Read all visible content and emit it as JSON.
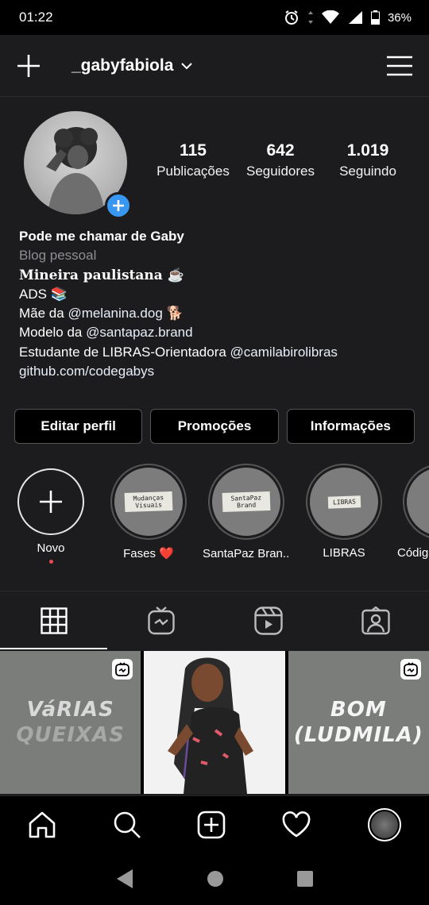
{
  "status": {
    "time": "01:22",
    "battery": "36%"
  },
  "header": {
    "username": "_gabyfabiola"
  },
  "stats": [
    {
      "value": "115",
      "label": "Publicações"
    },
    {
      "value": "642",
      "label": "Seguidores"
    },
    {
      "value": "1.019",
      "label": "Seguindo"
    }
  ],
  "bio": {
    "name": "Pode me chamar de Gaby",
    "category": "Blog pessoal",
    "line1": "Mineira paulistana ☕",
    "line2": "ADS 📚",
    "line3_prefix": "Mãe da ",
    "line3_mention": "@melanina.dog",
    "line3_suffix": " 🐕",
    "line4_prefix": "Modelo da ",
    "line4_mention": "@santapaz.brand",
    "line5_prefix": "Estudante de LIBRAS-Orientadora ",
    "line5_mention": "@camilabirolibras",
    "link": "github.com/codegabys"
  },
  "buttons": {
    "edit": "Editar perfil",
    "promo": "Promoções",
    "info": "Informações"
  },
  "highlights": [
    {
      "label": "Novo",
      "tag": ""
    },
    {
      "label": "Fases ❤️",
      "tag": "Mudanças Visuais"
    },
    {
      "label": "SantaPaz Bran...📱",
      "tag": "SantaPaz Brand"
    },
    {
      "label": "LIBRAS",
      "tag": "LIBRAS"
    },
    {
      "label": "Códig",
      "tag": ""
    }
  ],
  "posts": [
    {
      "line1": "VáRIAS",
      "line2": "QUEIXAS"
    },
    {
      "line1": "",
      "line2": ""
    },
    {
      "line1": "BOM",
      "line2": "(LUDMILA)"
    }
  ],
  "colors": {
    "background": "#1c1c1e",
    "accent": "#3897f0",
    "notification": "#ed4956"
  }
}
